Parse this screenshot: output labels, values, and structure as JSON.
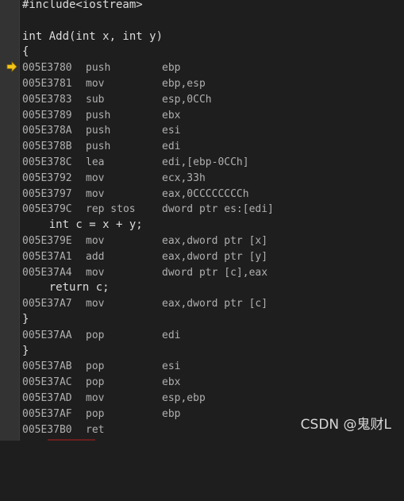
{
  "source_top": {
    "include": "#include<iostream>",
    "blank": "",
    "func_sig": "int Add(int x, int y)",
    "open_brace": "{"
  },
  "asm_block_1": [
    {
      "addr": "005E3780",
      "mnemonic": "push",
      "operands": "ebp"
    },
    {
      "addr": "005E3781",
      "mnemonic": "mov",
      "operands": "ebp,esp"
    },
    {
      "addr": "005E3783",
      "mnemonic": "sub",
      "operands": "esp,0CCh"
    },
    {
      "addr": "005E3789",
      "mnemonic": "push",
      "operands": "ebx"
    },
    {
      "addr": "005E378A",
      "mnemonic": "push",
      "operands": "esi"
    },
    {
      "addr": "005E378B",
      "mnemonic": "push",
      "operands": "edi"
    },
    {
      "addr": "005E378C",
      "mnemonic": "lea",
      "operands": "edi,[ebp-0CCh]"
    },
    {
      "addr": "005E3792",
      "mnemonic": "mov",
      "operands": "ecx,33h"
    },
    {
      "addr": "005E3797",
      "mnemonic": "mov",
      "operands": "eax,0CCCCCCCCh"
    },
    {
      "addr": "005E379C",
      "mnemonic": "rep stos",
      "operands": "dword ptr es:[edi]"
    }
  ],
  "source_stmt_1": "    int c = x + y;",
  "asm_block_2": [
    {
      "addr": "005E379E",
      "mnemonic": "mov",
      "operands": "eax,dword ptr [x]"
    },
    {
      "addr": "005E37A1",
      "mnemonic": "add",
      "operands": "eax,dword ptr [y]"
    },
    {
      "addr": "005E37A4",
      "mnemonic": "mov",
      "operands": "dword ptr [c],eax"
    }
  ],
  "source_stmt_2": "    return c;",
  "asm_block_3": [
    {
      "addr": "005E37A7",
      "mnemonic": "mov",
      "operands": "eax,dword ptr [c]"
    }
  ],
  "close_brace_1": "}",
  "asm_block_4": [
    {
      "addr": "005E37AA",
      "mnemonic": "pop",
      "operands": "edi"
    }
  ],
  "close_brace_2": "}",
  "asm_block_5": [
    {
      "addr": "005E37AB",
      "mnemonic": "pop",
      "operands": "esi"
    },
    {
      "addr": "005E37AC",
      "mnemonic": "pop",
      "operands": "ebx"
    },
    {
      "addr": "005E37AD",
      "mnemonic": "mov",
      "operands": "esp,ebp"
    },
    {
      "addr": "005E37AF",
      "mnemonic": "pop",
      "operands": "ebp"
    },
    {
      "addr": "005E37B0",
      "mnemonic": "ret",
      "operands": ""
    }
  ],
  "watermark": "CSDN @鬼财L",
  "colors": {
    "background": "#1e1e1e",
    "gutter": "#333333",
    "source_text": "#dcdcdc",
    "asm_text": "#b0b0b0",
    "arrow": "#f5c518"
  },
  "icons": {
    "current_instruction": "yellow-arrow-icon"
  }
}
